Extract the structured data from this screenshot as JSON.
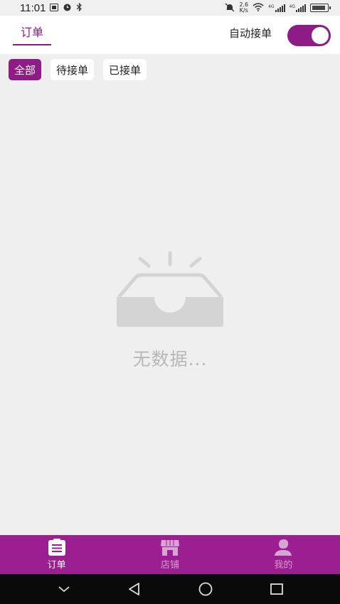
{
  "status_bar": {
    "time": "11:01",
    "net_speed_value": "2.6",
    "net_speed_unit": "K/s",
    "signal1_label": "4G",
    "signal2_label": "4G",
    "icons": [
      "sim-card-icon",
      "alarm-icon",
      "bluetooth-icon",
      "mute-icon",
      "wifi-icon",
      "signal-icon",
      "battery-icon"
    ]
  },
  "header": {
    "tab_label": "订单",
    "auto_accept_label": "自动接单",
    "auto_accept_on": true
  },
  "filters": [
    {
      "label": "全部",
      "active": true
    },
    {
      "label": "待接单",
      "active": false
    },
    {
      "label": "已接单",
      "active": false
    }
  ],
  "empty_state": {
    "text": "无数据...",
    "icon": "empty-tray-icon"
  },
  "tabbar": {
    "items": [
      {
        "label": "订单",
        "icon": "order-icon",
        "active": true
      },
      {
        "label": "店铺",
        "icon": "store-icon",
        "active": false
      },
      {
        "label": "我的",
        "icon": "user-icon",
        "active": false
      }
    ]
  },
  "navigation": {
    "icons": [
      "hide-keyboard-icon",
      "back-icon",
      "home-icon",
      "recents-icon"
    ]
  },
  "colors": {
    "accent": "#8f1b86",
    "tabbar_bg": "#9c1f91",
    "page_bg": "#efefef",
    "empty_text": "#b8b8b8"
  }
}
